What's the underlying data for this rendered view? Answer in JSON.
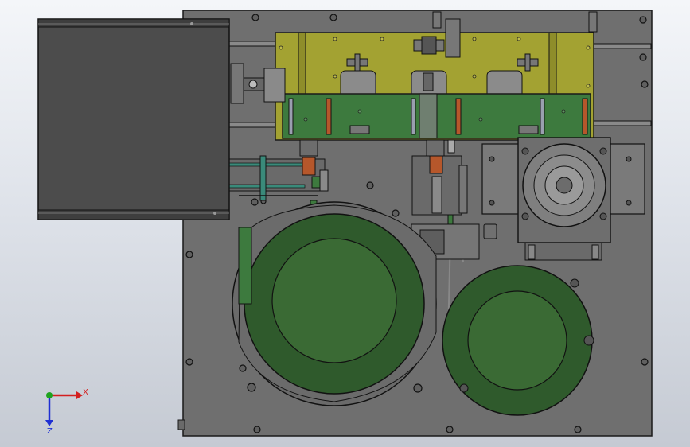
{
  "viewport": {
    "background_top": "#f4f6f9",
    "background_bottom": "#c5cad3"
  },
  "colors": {
    "plate": "#6f6f6f",
    "plate_dark": "#5c5c5c",
    "outline": "#1a1a1a",
    "yellow_frame": "#a3a232",
    "green_panel": "#3d7a3e",
    "green_disc": "#2f5a2c",
    "green_disc_inner": "#3a6a34",
    "copper": "#b6572b",
    "cover": "#4c4c4c",
    "rail": "#3a8a7a"
  },
  "triad": {
    "x_label": "X",
    "z_label": "Z",
    "x_color": "#d31f1f",
    "z_color": "#1f2fd3",
    "y_color": "#1fa31f"
  }
}
